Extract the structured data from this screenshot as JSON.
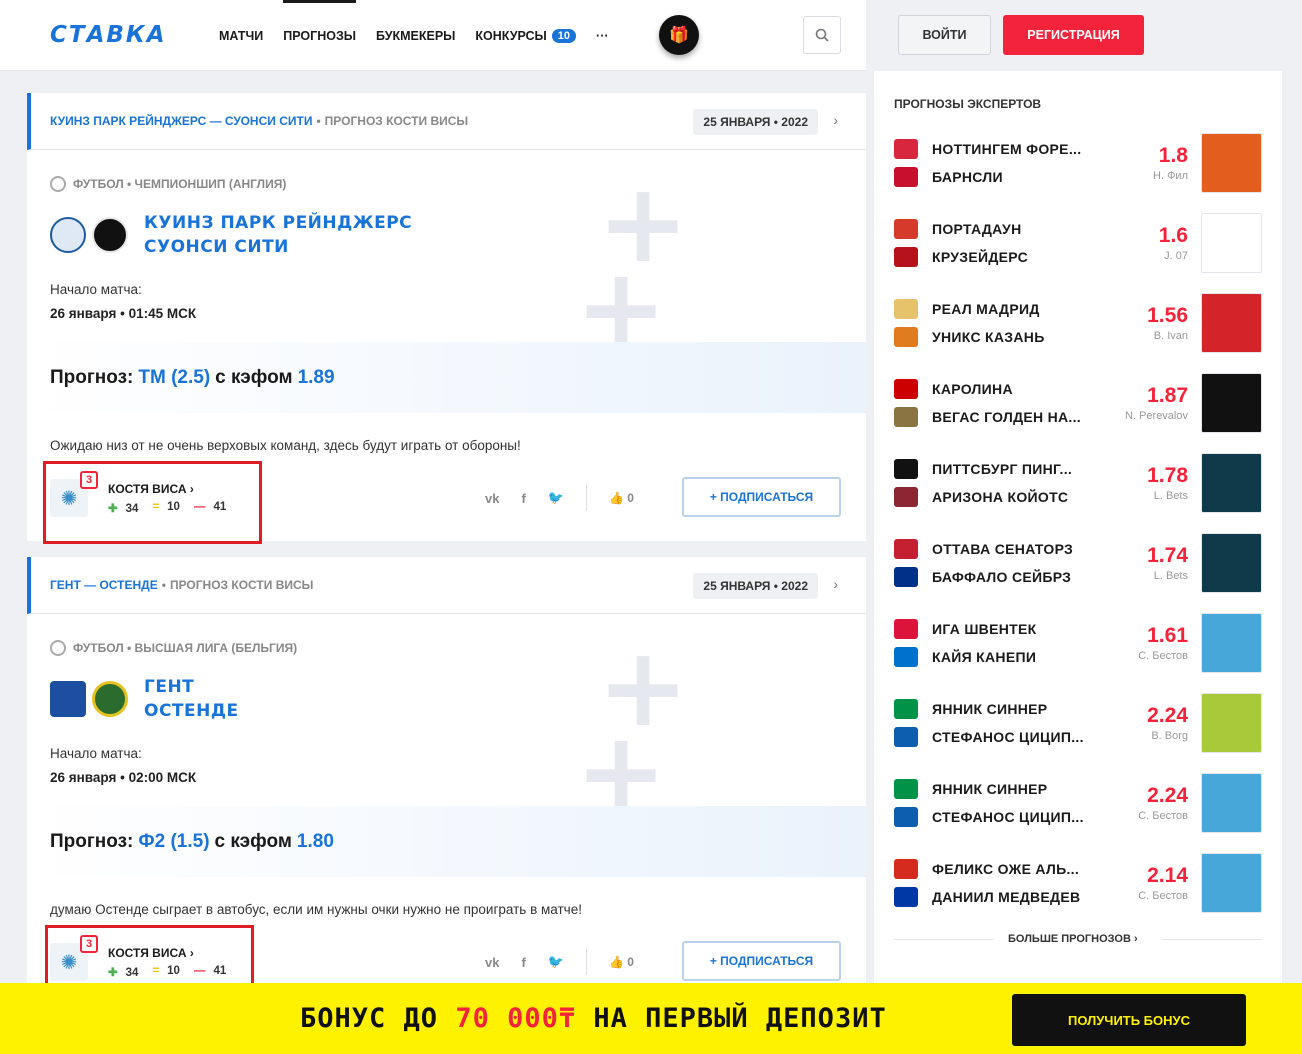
{
  "header": {
    "logo": "СТАВКА",
    "nav": [
      "МАТЧИ",
      "ПРОГНОЗЫ",
      "БУКМЕКЕРЫ",
      "КОНКУРСЫ"
    ],
    "contests_badge": "10",
    "more": "···",
    "login": "ВОЙТИ",
    "register": "РЕГИСТРАЦИЯ"
  },
  "cards": [
    {
      "match": "КУИНЗ ПАРК РЕЙНДЖЕРС — СУОНСИ СИТИ",
      "sep": "•",
      "forecast_of": "ПРОГНОЗ КОСТИ ВИСЫ",
      "date": "25 ЯНВАРЯ • 2022",
      "league": "ФУТБОЛ • ЧЕМПИОНШИП (АНГЛИЯ)",
      "team1": "КУИНЗ ПАРК РЕЙНДЖЕРС",
      "team2": "СУОНСИ СИТИ",
      "start_label": "Начало матча:",
      "start_value": "26 января • 01:45 МСК",
      "forecast_label": "Прогноз:",
      "bet": "ТМ (2.5)",
      "odds_label": "с кэфом",
      "odds": "1.89",
      "comment": "Ожидаю низ от не очень верховых команд, здесь будут играть от обороны!",
      "author": "КОСТЯ ВИСА",
      "level": "3",
      "wins": "34",
      "draws": "10",
      "losses": "41",
      "likes": "0",
      "subscribe": "+ ПОДПИСАТЬСЯ"
    },
    {
      "match": "ГЕНТ — ОСТЕНДЕ",
      "sep": "•",
      "forecast_of": "ПРОГНОЗ КОСТИ ВИСЫ",
      "date": "25 ЯНВАРЯ • 2022",
      "league": "ФУТБОЛ • ВЫСШАЯ ЛИГА (БЕЛЬГИЯ)",
      "team1": "ГЕНТ",
      "team2": "ОСТЕНДЕ",
      "start_label": "Начало матча:",
      "start_value": "26 января • 02:00 МСК",
      "forecast_label": "Прогноз:",
      "bet": "Ф2 (1.5)",
      "odds_label": "с кэфом",
      "odds": "1.80",
      "comment": "думаю Остенде сыграет в автобус, если им нужны очки нужно не проиграть в матче!",
      "author": "КОСТЯ ВИСА",
      "level": "3",
      "wins": "34",
      "draws": "10",
      "losses": "41",
      "likes": "0",
      "subscribe": "+ ПОДПИСАТЬСЯ"
    }
  ],
  "sidebar": {
    "title": "ПРОГНОЗЫ ЭКСПЕРТОВ",
    "items": [
      {
        "t1": "НОТТИНГЕМ ФОРЕ...",
        "t2": "БАРНСЛИ",
        "odds": "1.8",
        "expert": "Н. Фил",
        "c1": "#d7263d",
        "c2": "#c8102e",
        "img": "#e25d1e"
      },
      {
        "t1": "ПОРТАДАУН",
        "t2": "КРУЗЕЙДЕРС",
        "odds": "1.6",
        "expert": "J. 07",
        "c1": "#d63a2b",
        "c2": "#b5121b",
        "img": "#ffffff"
      },
      {
        "t1": "РЕАЛ МАДРИД",
        "t2": "УНИКС КАЗАНЬ",
        "odds": "1.56",
        "expert": "B. Ivan",
        "c1": "#e6c36a",
        "c2": "#e07b20",
        "img": "#d5232a"
      },
      {
        "t1": "КАРОЛИНА",
        "t2": "ВЕГАС ГОЛДЕН НА...",
        "odds": "1.87",
        "expert": "N. Perevalov",
        "c1": "#cc0000",
        "c2": "#8a7442",
        "img": "#111111"
      },
      {
        "t1": "ПИТТСБУРГ ПИНГ...",
        "t2": "АРИЗОНА КОЙОТС",
        "odds": "1.78",
        "expert": "L. Bets",
        "c1": "#111111",
        "c2": "#8c2633",
        "img": "#0f3a4a"
      },
      {
        "t1": "ОТТАВА СЕНАТОРЗ",
        "t2": "БАФФАЛО СЕЙБРЗ",
        "odds": "1.74",
        "expert": "L. Bets",
        "c1": "#c52032",
        "c2": "#003087",
        "img": "#0f3a4a"
      },
      {
        "t1": "ИГА ШВЕНТЕК",
        "t2": "КАЙЯ КАНЕПИ",
        "odds": "1.61",
        "expert": "С. Бестов",
        "c1": "#dc143c",
        "c2": "#0072ce",
        "img": "#47a7d8"
      },
      {
        "t1": "ЯННИК СИННЕР",
        "t2": "СТЕФАНОС ЦИЦИП...",
        "odds": "2.24",
        "expert": "B. Borg",
        "c1": "#009246",
        "c2": "#0d5eaf",
        "img": "#a8c93a"
      },
      {
        "t1": "ЯННИК СИННЕР",
        "t2": "СТЕФАНОС ЦИЦИП...",
        "odds": "2.24",
        "expert": "С. Бестов",
        "c1": "#009246",
        "c2": "#0d5eaf",
        "img": "#47a7d8"
      },
      {
        "t1": "ФЕЛИКС ОЖЕ АЛЬ...",
        "t2": "ДАНИИЛ МЕДВЕДЕВ",
        "odds": "2.14",
        "expert": "С. Бестов",
        "c1": "#d52b1e",
        "c2": "#0039a6",
        "img": "#47a7d8"
      }
    ],
    "more": "БОЛЬШЕ ПРОГНОЗОВ ›"
  },
  "bonus": {
    "text_before": "БОНУС ДО ",
    "amount": "70 000₸",
    "text_after": " НА ПЕРВЫЙ ДЕПОЗИТ",
    "button": "ПОЛУЧИТЬ БОНУС"
  }
}
